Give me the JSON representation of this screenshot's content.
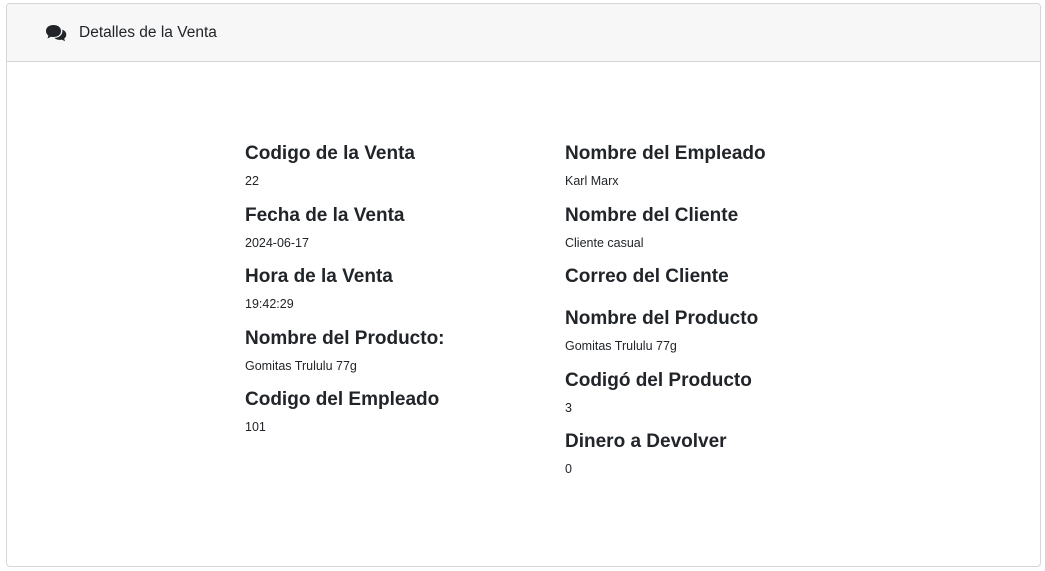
{
  "header": {
    "title": "Detalles de la Venta",
    "icon": "comments-icon"
  },
  "left_column": [
    {
      "label": "Codigo de la Venta",
      "value": "22"
    },
    {
      "label": "Fecha de la Venta",
      "value": "2024-06-17"
    },
    {
      "label": "Hora de la Venta",
      "value": "19:42:29"
    },
    {
      "label": "Nombre del Producto:",
      "value": "Gomitas Trululu 77g"
    },
    {
      "label": "Codigo del Empleado",
      "value": "101"
    }
  ],
  "right_column": [
    {
      "label": "Nombre del Empleado",
      "value": "Karl Marx"
    },
    {
      "label": "Nombre del Cliente",
      "value": "Cliente casual"
    },
    {
      "label": "Correo del Cliente",
      "value": ""
    },
    {
      "label": "Nombre del Producto",
      "value": "Gomitas Trululu 77g"
    },
    {
      "label": "Codigó del Producto",
      "value": "3"
    },
    {
      "label": "Dinero a Devolver",
      "value": "0"
    }
  ]
}
